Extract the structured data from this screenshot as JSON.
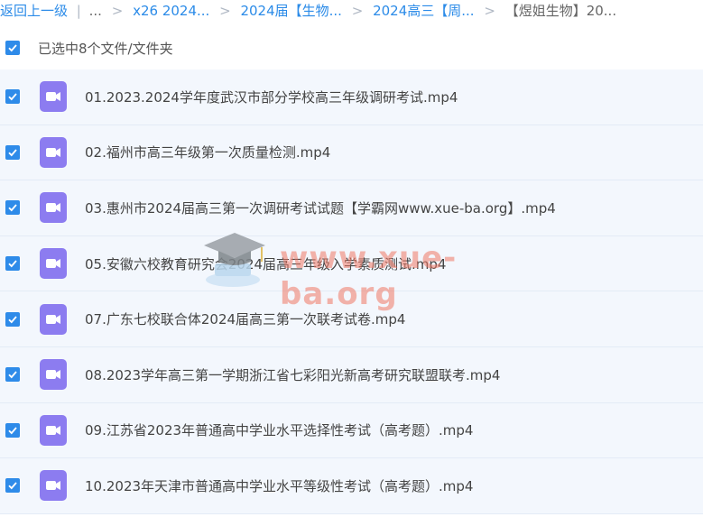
{
  "breadcrumb": {
    "back": "返回上一级",
    "sep": "|",
    "ellipsis": "...",
    "arrow": ">",
    "items": [
      "x26 2024...",
      "2024届【生物...",
      "2024高三【周...",
      "【煜姐生物】20..."
    ]
  },
  "selection": {
    "text": "已选中8个文件/文件夹",
    "checked": true
  },
  "files": [
    {
      "name": "01.2023.2024学年度武汉市部分学校高三年级调研考试.mp4",
      "checked": true,
      "icon": "video-file-icon"
    },
    {
      "name": "02.福州市高三年级第一次质量检测.mp4",
      "checked": true,
      "icon": "video-file-icon"
    },
    {
      "name": "03.惠州市2024届高三第一次调研考试试题【学霸网www.xue-ba.org】.mp4",
      "checked": true,
      "icon": "video-file-icon"
    },
    {
      "name": "05.安徽六校教育研究会2024届高三年级入学素质测试.mp4",
      "checked": true,
      "icon": "video-file-icon"
    },
    {
      "name": "07.广东七校联合体2024届高三第一次联考试卷.mp4",
      "checked": true,
      "icon": "video-file-icon"
    },
    {
      "name": "08.2023学年高三第一学期浙江省七彩阳光新高考研究联盟联考.mp4",
      "checked": true,
      "icon": "video-file-icon"
    },
    {
      "name": "09.江苏省2023年普通高中学业水平选择性考试（高考题）.mp4",
      "checked": true,
      "icon": "video-file-icon"
    },
    {
      "name": "10.2023年天津市普通高中学业水平等级性考试（高考题）.mp4",
      "checked": true,
      "icon": "video-file-icon"
    }
  ],
  "watermark": {
    "text": "www.xue-ba.org"
  },
  "colors": {
    "accent": "#2e8be9",
    "link": "#2b8be8",
    "row_bg": "#f3f7fd",
    "video_icon": "#8c7cf0"
  }
}
